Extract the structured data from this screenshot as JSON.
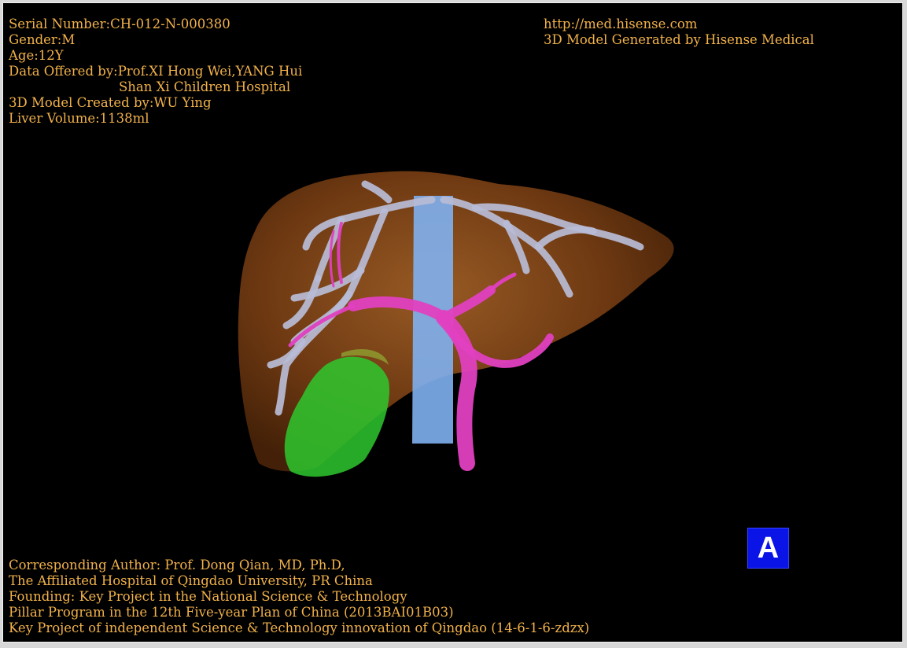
{
  "header": {
    "serial": "Serial Number:CH-012-N-000380",
    "gender": "Gender:M",
    "age": "Age:12Y",
    "data_offered": "Data Offered by:Prof.XI Hong Wei,YANG Hui",
    "hospital": "Shan Xi Children Hospital",
    "created_by": "3D Model Created by:WU Ying",
    "volume": "Liver Volume:1138ml"
  },
  "site": {
    "url": "http://med.hisense.com",
    "generated": "3D Model Generated by Hisense Medical"
  },
  "footer": {
    "line1": "Corresponding Author: Prof. Dong Qian, MD, Ph.D,",
    "line2": "The Affiliated Hospital of Qingdao University, PR China",
    "line3": "Founding: Key Project in the National Science & Technology",
    "line4": "Pillar Program in the 12th Five-year Plan of China (2013BAI01B03)",
    "line5": "Key Project of independent Science & Technology innovation of Qingdao (14-6-1-6-zdzx)"
  },
  "view_badge": "A",
  "colors": {
    "text": "#f2b24a",
    "liver": "#8a4a18",
    "hepatic_veins": "#b8bcd6",
    "vena_cava": "#7fb0f0",
    "portal_vein": "#e040c0",
    "gallbladder": "#2ec82e",
    "badge": "#0a14e6"
  }
}
